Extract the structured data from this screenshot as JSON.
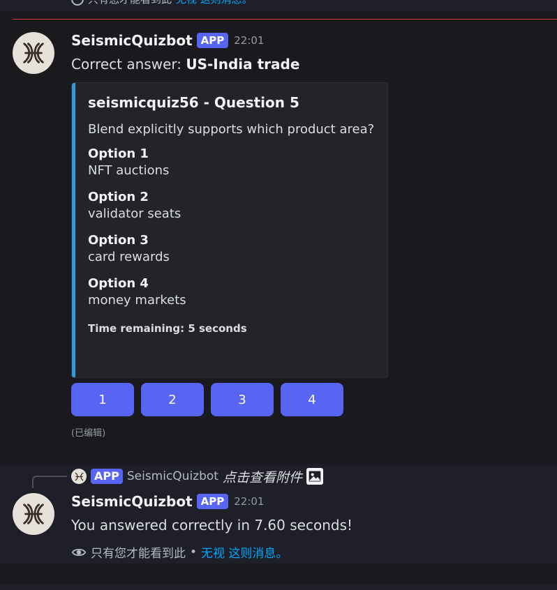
{
  "top_partial": {
    "text": "只有您才能看到此",
    "link": "无视 这则消息。"
  },
  "message1": {
    "username": "SeismicQuizbot",
    "badge": "APP",
    "timestamp": "22:01",
    "content_prefix": "Correct answer: ",
    "content_bold": "US-India trade",
    "embed": {
      "accent_color": "#3498db",
      "title": "seismicquiz56 - Question 5",
      "description": "Blend explicitly supports which product area?",
      "fields": [
        {
          "name": "Option 1",
          "value": "NFT auctions"
        },
        {
          "name": "Option 2",
          "value": "validator seats"
        },
        {
          "name": "Option 3",
          "value": "card rewards"
        },
        {
          "name": "Option 4",
          "value": "money markets"
        }
      ],
      "footer": "Time remaining: 5 seconds"
    },
    "buttons": [
      "1",
      "2",
      "3",
      "4"
    ],
    "edited_label": "(已编辑)"
  },
  "message2": {
    "reply": {
      "badge": "APP",
      "username": "SeismicQuizbot",
      "text": "点击查看附件"
    },
    "username": "SeismicQuizbot",
    "badge": "APP",
    "timestamp": "22:01",
    "content": "You answered correctly in 7.60 seconds!",
    "ephemeral_note": "只有您才能看到此",
    "separator": "•",
    "dismiss_link": "无视 这则消息。"
  },
  "colors": {
    "background": "#1a1a1e",
    "ephemeral_background": "#1e1f29",
    "brand": "#5865f2",
    "link": "#00a8fc",
    "new_messages_divider": "#d83c3e"
  },
  "icons": [
    "seismic-logo-icon",
    "eye-icon",
    "image-icon"
  ]
}
